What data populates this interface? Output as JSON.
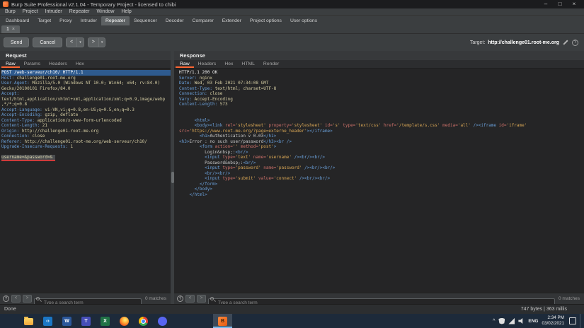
{
  "window": {
    "title": "Burp Suite Professional v2.1.04 - Temporary Project - licensed to chibi",
    "controls": {
      "minimize": "–",
      "maximize": "□",
      "close": "×"
    }
  },
  "icons": {
    "question": "?"
  },
  "menubar": {
    "items": [
      "Burp",
      "Project",
      "Intruder",
      "Repeater",
      "Window",
      "Help"
    ]
  },
  "main_tabs": {
    "items": [
      "Dashboard",
      "Target",
      "Proxy",
      "Intruder",
      "Repeater",
      "Sequencer",
      "Decoder",
      "Comparer",
      "Extender",
      "Project options",
      "User options"
    ],
    "selected": "Repeater"
  },
  "repeater_tabs": {
    "items": [
      "1"
    ],
    "selected": "1",
    "close_glyph": "×"
  },
  "toolbar": {
    "send_label": "Send",
    "cancel_label": "Cancel",
    "prev_label": "<",
    "next_label": ">",
    "dropdown_glyph": "▾",
    "target_label": "Target:",
    "target_value": "http://challenge01.root-me.org"
  },
  "request_panel": {
    "title": "Request",
    "tabs": [
      "Raw",
      "Params",
      "Headers",
      "Hex"
    ],
    "selected_tab": "Raw",
    "lines": [
      {
        "cls": "selected",
        "seg": [
          [
            "w",
            "POST /web-serveur/ch10/ HTTP/1.1"
          ]
        ]
      },
      {
        "seg": [
          [
            "n",
            "Host:"
          ],
          [
            "v",
            " challenge01.root-me.org"
          ]
        ]
      },
      {
        "seg": [
          [
            "n",
            "User-Agent:"
          ],
          [
            "v",
            " Mozilla/5.0 (Windows NT 10.0; Win64; x64; rv:84.0)"
          ]
        ]
      },
      {
        "seg": [
          [
            "v",
            "Gecko/20100101 Firefox/84.0"
          ]
        ]
      },
      {
        "seg": [
          [
            "n",
            "Accept:"
          ]
        ]
      },
      {
        "seg": [
          [
            "v",
            "text/html,application/xhtml+xml,application/xml;q=0.9,image/webp"
          ]
        ]
      },
      {
        "seg": [
          [
            "v",
            ",*/*;q=0.8"
          ]
        ]
      },
      {
        "seg": [
          [
            "n",
            "Accept-Language:"
          ],
          [
            "v",
            " vi-VN,vi;q=0.8,en-US;q=0.5,en;q=0.3"
          ]
        ]
      },
      {
        "seg": [
          [
            "n",
            "Accept-Encoding:"
          ],
          [
            "v",
            " gzip, deflate"
          ]
        ]
      },
      {
        "seg": [
          [
            "n",
            "Content-Type:"
          ],
          [
            "v",
            " application/x-www-form-urlencoded"
          ]
        ]
      },
      {
        "seg": [
          [
            "n",
            "Content-Length:"
          ],
          [
            "v",
            " 21"
          ]
        ]
      },
      {
        "seg": [
          [
            "n",
            "Origin:"
          ],
          [
            "v",
            " http://challenge01.root-me.org"
          ]
        ]
      },
      {
        "seg": [
          [
            "n",
            "Connection:"
          ],
          [
            "v",
            " close"
          ]
        ]
      },
      {
        "seg": [
          [
            "n",
            "Referer:"
          ],
          [
            "v",
            " http://challenge01.root-me.org/web-serveur/ch10/"
          ]
        ]
      },
      {
        "seg": [
          [
            "n",
            "Upgrade-Insecure-Requests:"
          ],
          [
            "v",
            " 1"
          ]
        ]
      },
      {
        "seg": []
      },
      {
        "seg": [
          [
            "b",
            "username=&password=&"
          ]
        ]
      }
    ]
  },
  "response_panel": {
    "title": "Response",
    "tabs": [
      "Raw",
      "Headers",
      "Hex",
      "HTML",
      "Render"
    ],
    "selected_tab": "Raw",
    "lines": [
      {
        "seg": [
          [
            "w",
            "HTTP/1.1 200 OK"
          ]
        ]
      },
      {
        "seg": [
          [
            "n",
            "Server:"
          ],
          [
            "v",
            " nginx"
          ]
        ]
      },
      {
        "seg": [
          [
            "n",
            "Date:"
          ],
          [
            "v",
            " Wed, 03 Feb 2021 07:34:08 GMT"
          ]
        ]
      },
      {
        "seg": [
          [
            "n",
            "Content-Type:"
          ],
          [
            "v",
            " text/html; charset=UTF-8"
          ]
        ]
      },
      {
        "seg": [
          [
            "n",
            "Connection:"
          ],
          [
            "v",
            " close"
          ]
        ]
      },
      {
        "seg": [
          [
            "n",
            "Vary:"
          ],
          [
            "v",
            " Accept-Encoding"
          ]
        ]
      },
      {
        "seg": [
          [
            "n",
            "Content-Length:"
          ],
          [
            "v",
            " 573"
          ]
        ]
      },
      {
        "seg": []
      },
      {
        "seg": []
      },
      {
        "seg": [
          [
            "t",
            "      <html>"
          ]
        ]
      },
      {
        "seg": [
          [
            "t",
            "      <body><link "
          ],
          [
            "a",
            "rel="
          ],
          [
            "s",
            "'stylesheet' "
          ],
          [
            "a",
            "property="
          ],
          [
            "s",
            "'stylesheet' "
          ],
          [
            "a",
            "id="
          ],
          [
            "s",
            "'s' "
          ],
          [
            "a",
            "type="
          ],
          [
            "s",
            "'text/css' "
          ],
          [
            "a",
            "href="
          ],
          [
            "s",
            "'/template/s.css' "
          ],
          [
            "a",
            "media="
          ],
          [
            "s",
            "'all' "
          ],
          [
            "t",
            "/><iframe "
          ],
          [
            "a",
            "id="
          ],
          [
            "s",
            "'iframe'"
          ]
        ]
      },
      {
        "seg": [
          [
            "a",
            "src="
          ],
          [
            "s",
            "'https://www.root-me.org/?page=externe_header'"
          ],
          [
            "t",
            "></iframe>"
          ]
        ]
      },
      {
        "seg": [
          [
            "t",
            "        <h1>"
          ],
          [
            "p",
            "Authentication v 0.03"
          ],
          [
            "t",
            "</h1>"
          ]
        ]
      },
      {
        "seg": [
          [
            "t",
            "<h3>"
          ],
          [
            "p",
            "Error : no such user/password"
          ],
          [
            "t",
            "</h3><br />"
          ]
        ]
      },
      {
        "seg": [
          [
            "t",
            "        <form "
          ],
          [
            "a",
            "action="
          ],
          [
            "s",
            "'' "
          ],
          [
            "a",
            "method="
          ],
          [
            "s",
            "'post'"
          ],
          [
            "t",
            ">"
          ]
        ]
      },
      {
        "seg": [
          [
            "p",
            "          Login&nbsp;:"
          ],
          [
            "t",
            "<br/>"
          ]
        ]
      },
      {
        "seg": [
          [
            "t",
            "          <input "
          ],
          [
            "a",
            "type="
          ],
          [
            "s",
            "'text' "
          ],
          [
            "a",
            "name="
          ],
          [
            "s",
            "'username' "
          ],
          [
            "t",
            "/><br/><br/>"
          ]
        ]
      },
      {
        "seg": [
          [
            "p",
            "          Password&nbsp;:"
          ],
          [
            "t",
            "<br/>"
          ]
        ]
      },
      {
        "seg": [
          [
            "t",
            "          <input "
          ],
          [
            "a",
            "type="
          ],
          [
            "s",
            "'password' "
          ],
          [
            "a",
            "name="
          ],
          [
            "s",
            "'password' "
          ],
          [
            "t",
            "/><br/><br/>"
          ]
        ]
      },
      {
        "seg": [
          [
            "t",
            "          <br/><br/>"
          ]
        ]
      },
      {
        "seg": [
          [
            "t",
            "          <input "
          ],
          [
            "a",
            "type="
          ],
          [
            "s",
            "'submit' "
          ],
          [
            "a",
            "value="
          ],
          [
            "s",
            "'connect' "
          ],
          [
            "t",
            "/><br/><br/>"
          ]
        ]
      },
      {
        "seg": [
          [
            "t",
            "        </form>"
          ]
        ]
      },
      {
        "seg": [
          [
            "t",
            "      </body>"
          ]
        ]
      },
      {
        "seg": [
          [
            "t",
            "    </html>"
          ]
        ]
      }
    ]
  },
  "search": {
    "placeholder": "Type a search term",
    "prev_glyph": "<",
    "next_glyph": ">",
    "request_matches": "0 matches",
    "response_matches": "0 matches"
  },
  "statusbar": {
    "left": "Done",
    "right": "747 bytes | 363 millis"
  },
  "taskbar": {
    "icons": [
      {
        "name": "start-button",
        "icon": "windows-logo-icon",
        "kind": "windows"
      },
      {
        "name": "taskbar-file-explorer-button",
        "icon": "folder-icon",
        "kind": "folder"
      },
      {
        "name": "taskbar-vscode-button",
        "icon": "vscode-icon",
        "kind": "app",
        "color": "#1b76c4",
        "glyph": "‹›"
      },
      {
        "name": "taskbar-word-button",
        "icon": "word-icon",
        "kind": "app",
        "color": "#2b579a",
        "glyph": "W"
      },
      {
        "name": "taskbar-teams-button",
        "icon": "teams-icon",
        "kind": "app",
        "color": "#464eb8",
        "glyph": "T"
      },
      {
        "name": "taskbar-excel-button",
        "icon": "excel-icon",
        "kind": "app",
        "color": "#217346",
        "glyph": "X"
      },
      {
        "name": "taskbar-firefox-button",
        "icon": "firefox-icon",
        "kind": "firefox"
      },
      {
        "name": "taskbar-chrome-button",
        "icon": "chrome-icon",
        "kind": "chrome"
      },
      {
        "name": "taskbar-discord-button",
        "icon": "discord-icon",
        "kind": "circle",
        "color": "#5865f2"
      },
      {
        "name": "taskbar-burp-button",
        "icon": "burp-icon",
        "kind": "burp",
        "active": true,
        "gap": 58,
        "glyph": "B"
      }
    ],
    "tray": {
      "chevron": "^",
      "lang": "ENG",
      "time": "2:34 PM",
      "date": "03/02/2021"
    }
  },
  "colors": {
    "accent_orange": "#ff6633",
    "selection_blue": "#2e5a8e",
    "header_name": "#6a9fd8",
    "header_value": "#d3cba2",
    "tag": "#6a9fd8",
    "attr": "#cc7069",
    "string": "#d8a655"
  }
}
